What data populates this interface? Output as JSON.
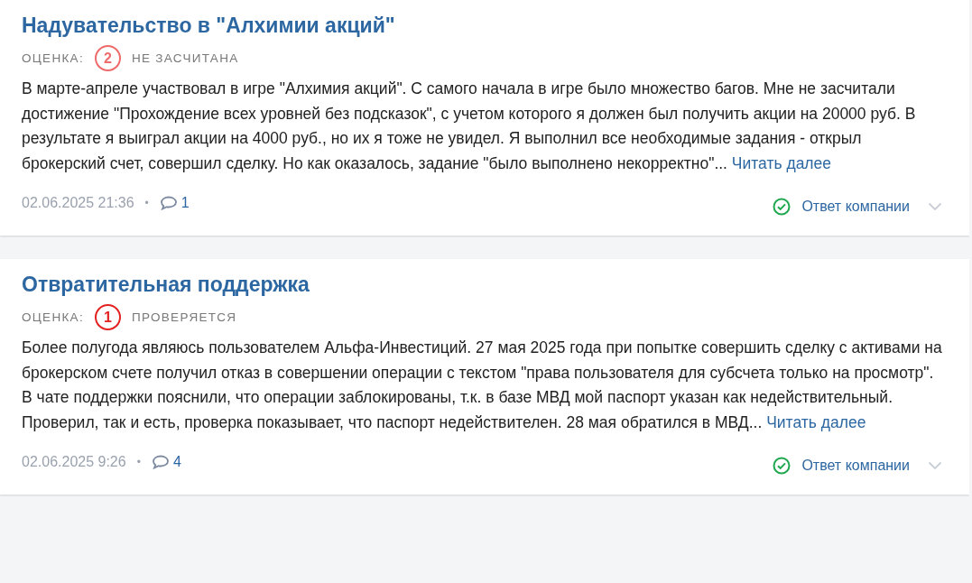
{
  "reviews": [
    {
      "title": "Надувательство в \"Алхимии акций\"",
      "rating_label": "ОЦЕНКА:",
      "score": "2",
      "color": "#ef6a6a",
      "status": "НЕ ЗАСЧИТАНА",
      "text": "В марте-апреле участвовал в игре \"Алхимия акций\". С самого начала в игре было множество багов. Мне не засчитали достижение \"Прохождение всех уровней без подсказок\", с учетом которого я должен был получить акции на 20000 руб. В результате я выиграл акции на 4000 руб., но их я тоже не увидел. Я выполнил все необходимые задания - открыл брокерский счет, совершил сделку. Но как оказалось, задание \"было выполнено некорректно\"...",
      "read_more": "Читать далее",
      "date": "02.06.2025 21:36",
      "separator": "•",
      "comments": "1",
      "company_reply": "Ответ компании",
      "expanded": false
    },
    {
      "title": "Отвратительная поддержка",
      "rating_label": "ОЦЕНКА:",
      "score": "1",
      "color": "#e42222",
      "status": "ПРОВЕРЯЕТСЯ",
      "text": "Более полугода являюсь пользователем Альфа-Инвестиций. 27 мая 2025 года при попытке совершить сделку с активами на брокерском счете получил отказ в совершении операции с текстом \"права пользователя для субсчета только на просмотр\". В чате поддержки пояснили, что операции заблокированы, т.к. в базе МВД мой паспорт указан как недействительный. Проверил, так и есть, проверка показывает, что паспорт недействителен. 28 мая обратился в МВД...",
      "read_more": "Читать далее",
      "date": "02.06.2025 9:26",
      "separator": "•",
      "comments": "4",
      "company_reply": "Ответ компании",
      "expanded": false
    }
  ]
}
